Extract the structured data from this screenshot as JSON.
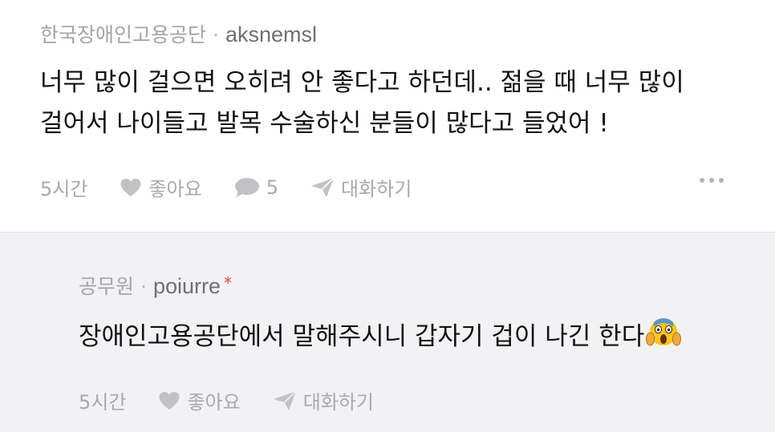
{
  "comments": [
    {
      "org": "한국장애인고용공단",
      "separator": "·",
      "nickname": "aksnemsl",
      "text": "너무 많이 걸으면 오히려 안 좋다고 하던데.. 젊을 때 너무 많이\n걸어서 나이들고 발목 수술하신 분들이 많다고 들었어 !",
      "time": "5시간",
      "like_label": "좋아요",
      "reply_count": "5",
      "chat_label": "대화하기"
    },
    {
      "org": "공무원",
      "separator": "·",
      "nickname": "poiurre",
      "nickname_mark": "*",
      "text": "장애인고용공단에서 말해주시니 갑자기 겁이 나긴 한다",
      "emoji": "screaming-face",
      "time": "5시간",
      "like_label": "좋아요",
      "chat_label": "대화하기"
    }
  ],
  "colors": {
    "reply_background": "#f2f2f4",
    "meta_text": "#a4a4a8",
    "body_text": "#111111",
    "mark": "#e8453c"
  }
}
